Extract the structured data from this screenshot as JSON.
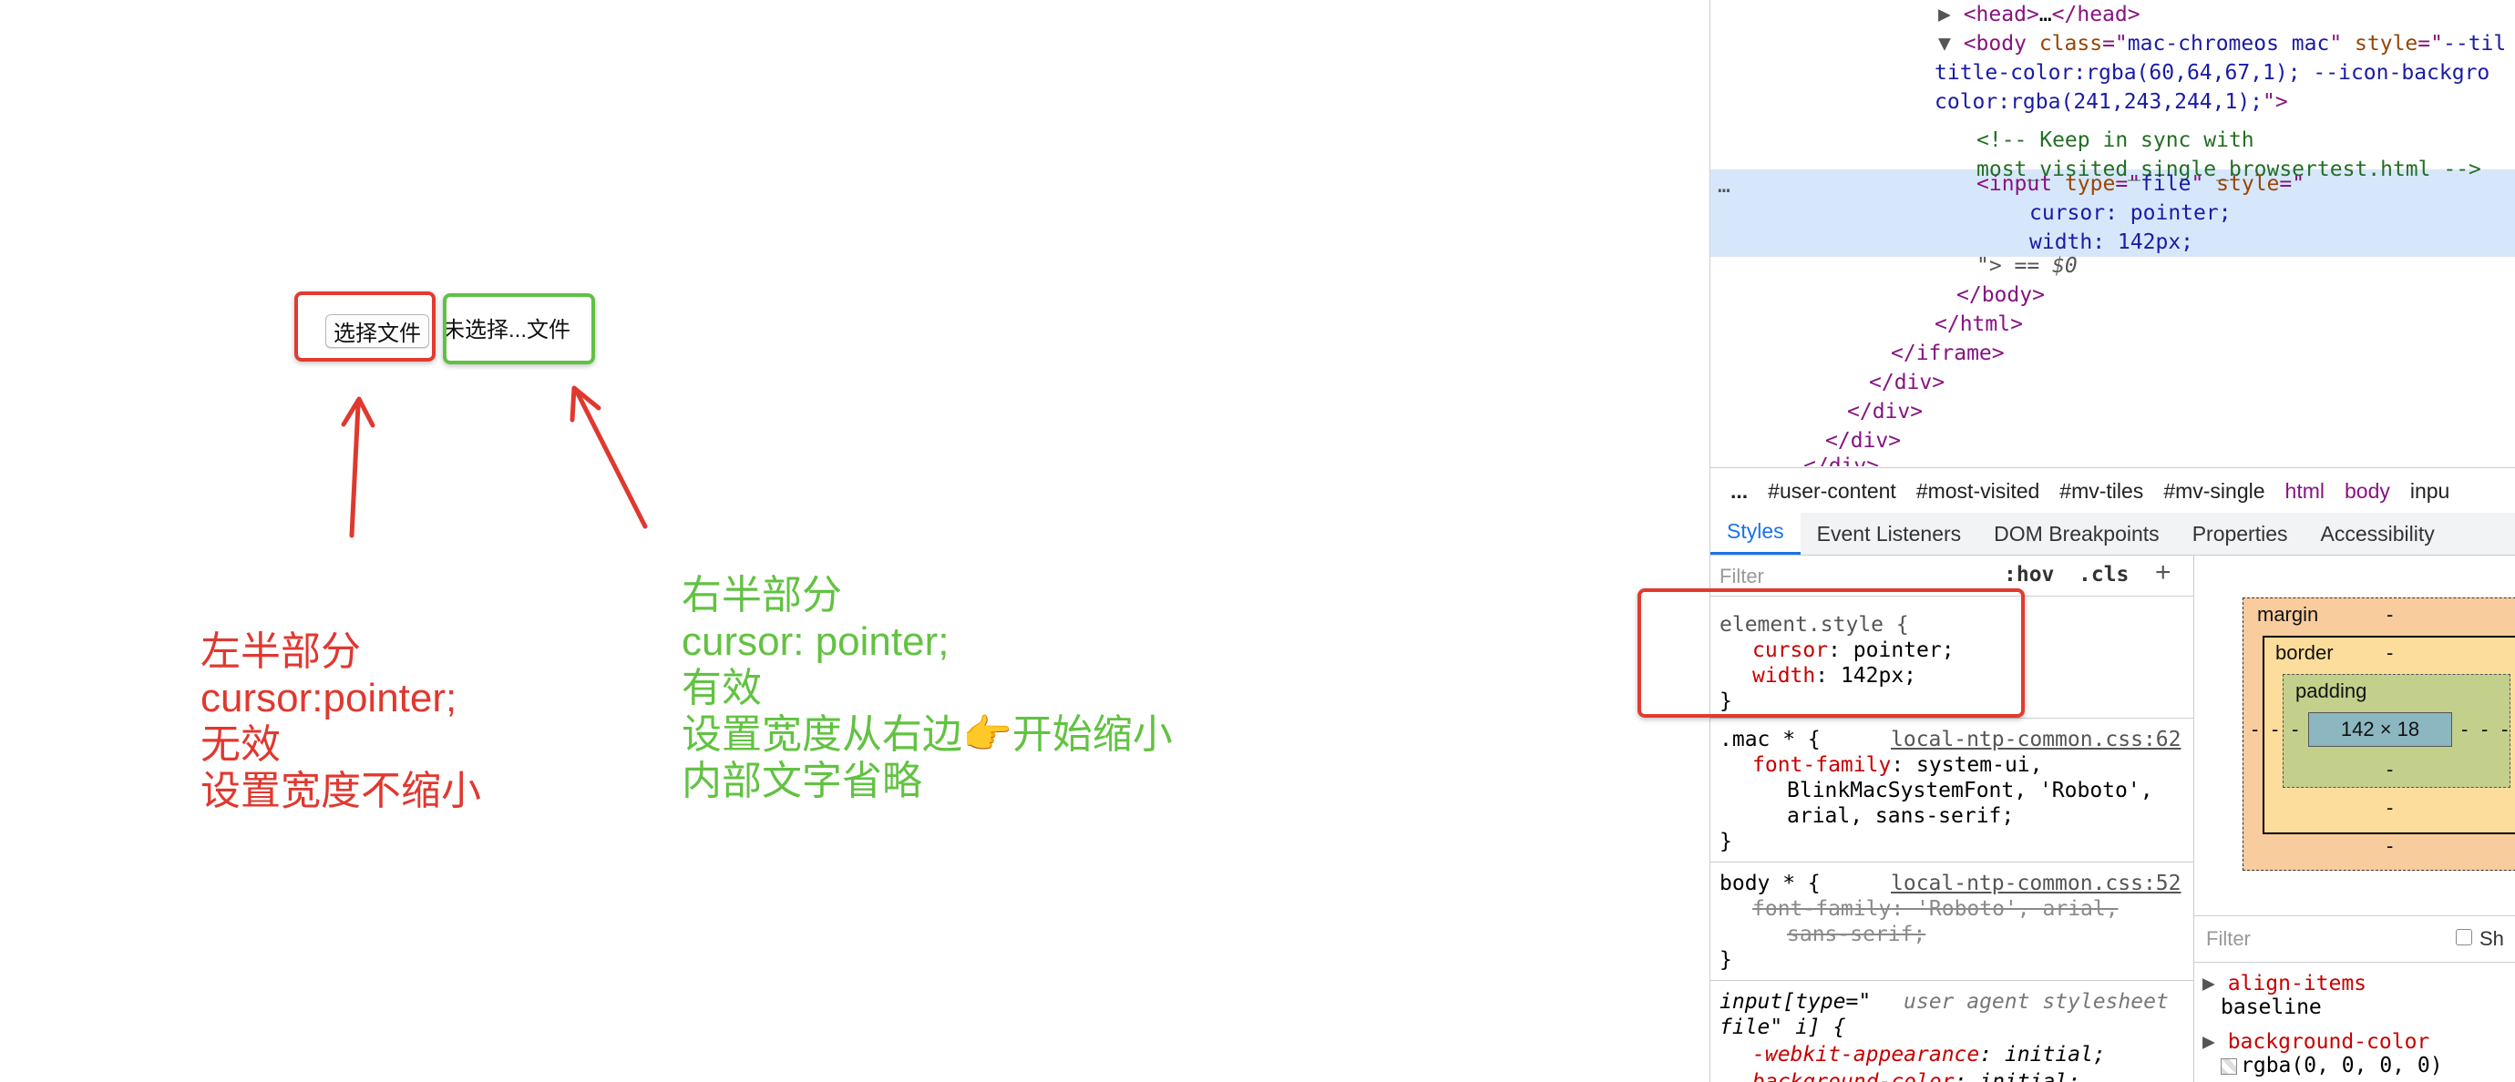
{
  "demo": {
    "file_button_label": "选择文件",
    "file_status_text": "未选择...文件",
    "left_note": [
      "左半部分",
      "cursor:pointer;",
      "无效",
      "设置宽度不缩小"
    ],
    "right_note": [
      "右半部分",
      "cursor: pointer;",
      "有效",
      "设置宽度从右边👉开始缩小",
      "内部文字省略"
    ]
  },
  "devtools": {
    "dom": {
      "head": [
        "<head>",
        "…",
        "</head>"
      ],
      "body_open": [
        "<body",
        "class",
        "mac-chromeos mac",
        "style",
        "--til"
      ],
      "body_cont1": "title-color:rgba(60,64,67,1); --icon-backgro",
      "body_cont2": "color:rgba(241,243,244,1);",
      "comment1": "<!-- Keep in sync with",
      "comment2": "most_visited_single_browsertest.html -->",
      "input_open": [
        "<input",
        "type",
        "file",
        "style"
      ],
      "input_style1": "cursor: pointer;",
      "input_style2": "width: 142px;",
      "input_close": "\"> == $0",
      "ellipsis": "…",
      "closers": [
        "</body>",
        "</html>",
        "</iframe>",
        "</div>",
        "</div>",
        "</div>",
        "</div>"
      ]
    },
    "breadcrumbs": [
      "...",
      "#user-content",
      "#most-visited",
      "#mv-tiles",
      "#mv-single",
      "html",
      "body",
      "inpu"
    ],
    "tabs": [
      "Styles",
      "Event Listeners",
      "DOM Breakpoints",
      "Properties",
      "Accessibility"
    ],
    "filter_placeholder": "Filter",
    "hov": ":hov",
    "cls": ".cls",
    "plus": "+",
    "rules": {
      "element_style": {
        "selector": "element.style {",
        "decls": [
          [
            "cursor",
            ": pointer;"
          ],
          [
            "width",
            ": 142px;"
          ]
        ],
        "close": "}"
      },
      "mac": {
        "selector": ".mac * {",
        "source": "local-ntp-common.css:62",
        "prop": "font-family",
        "val1": ": system-ui,",
        "val2": "BlinkMacSystemFont, 'Roboto',",
        "val3": "arial, sans-serif;",
        "close": "}"
      },
      "body": {
        "selector": "body * {",
        "source": "local-ntp-common.css:52",
        "prop": "font-family",
        "val1": ": 'Roboto', arial,",
        "val2": "sans-serif;",
        "close": "}"
      },
      "ua": {
        "selector1": "input[type=\"",
        "selector2": "file\" i] {",
        "source": "user agent stylesheet",
        "prop": "-webkit-appearance",
        "val": ": initial;",
        "prop2": "background-color",
        "val2": ": initial;"
      }
    },
    "box_model": {
      "margin": "margin",
      "border": "border",
      "padding": "padding",
      "content": "142 × 18",
      "dash": "-"
    },
    "computed": {
      "filter": "Filter",
      "show": "Sh",
      "items": [
        {
          "name": "align-items",
          "value": "baseline"
        },
        {
          "name": "background-color",
          "value": "rgba(0, 0, 0, 0)"
        }
      ]
    }
  }
}
